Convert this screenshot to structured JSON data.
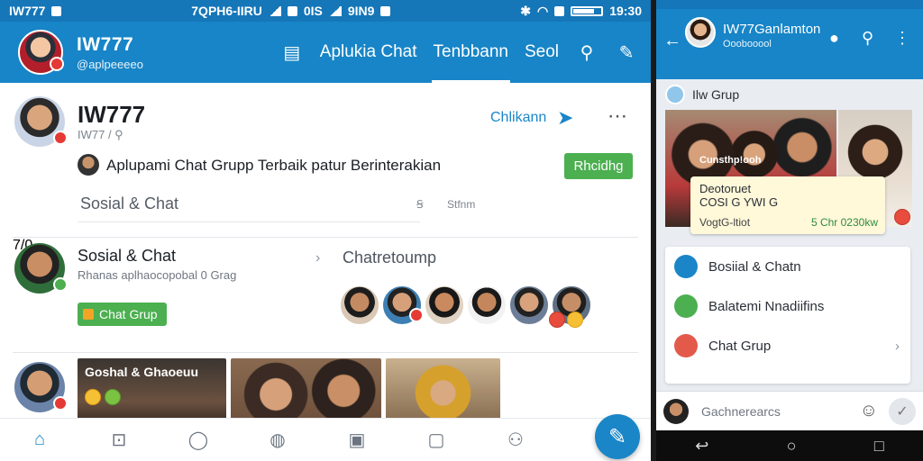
{
  "status": {
    "left": "IW777",
    "middle": "7QPH6-IIRU",
    "wifi_text": "0IS",
    "percent": "9IN9",
    "time": "19:30"
  },
  "appbar": {
    "title": "IW777",
    "subtitle": "@aplpeeeeo",
    "nav": [
      {
        "label": "Aplukia Chat",
        "active": false
      },
      {
        "label": "Tenbbann",
        "active": true
      },
      {
        "label": "Seol",
        "active": false
      }
    ],
    "icons": [
      "post-icon",
      "search-icon",
      "compose-icon"
    ]
  },
  "post1": {
    "name": "IW777",
    "sub": "IW77 / ⚲",
    "follow": "Chlikann",
    "headline": "Aplupami Chat Grupp Terbaik patur Berinterakian",
    "button": "Rhcidhg",
    "input_placeholder": "Sosial & Chat",
    "count_a": "Ꞩ",
    "count_b": "Stfnm"
  },
  "post2": {
    "name": "Sosial & Chat",
    "desc": "Rhanas aplhaocopobal 0 Grag",
    "group_title": "Chatretoump",
    "chip": "Chat Grup",
    "member_count": "7/0"
  },
  "post3": {
    "photo_caption": "Goshal & Ghaoeuu"
  },
  "bottom_nav": [
    "home-icon",
    "inbox-icon",
    "chat-icon",
    "explore-icon",
    "bag-icon",
    "stories-icon",
    "profile-icon"
  ],
  "right_panel": {
    "title": "IW77Ganlamton",
    "subtitle": "Ooobooool",
    "group_label": "Ilw Grup",
    "photo_caption": "Cunsthp!ooh",
    "card": {
      "line1": "Deotoruet",
      "line2": "COSI G YWI G",
      "foot": "VogtG-ltiot",
      "foot_right": "5 Chr 0230kw"
    },
    "menu": [
      {
        "label": "Bosiial & Chatn",
        "icon_color": "#1a86c8",
        "chevron": false
      },
      {
        "label": "Balatemi  Nnadiifins",
        "icon_color": "#4caf50",
        "chevron": false
      },
      {
        "label": "Chat Grup",
        "icon_color": "#e35a4b",
        "chevron": true
      }
    ],
    "input_placeholder": "Gachnerearcs"
  },
  "colors": {
    "primary": "#1785c7",
    "accent_green": "#4caf50"
  }
}
